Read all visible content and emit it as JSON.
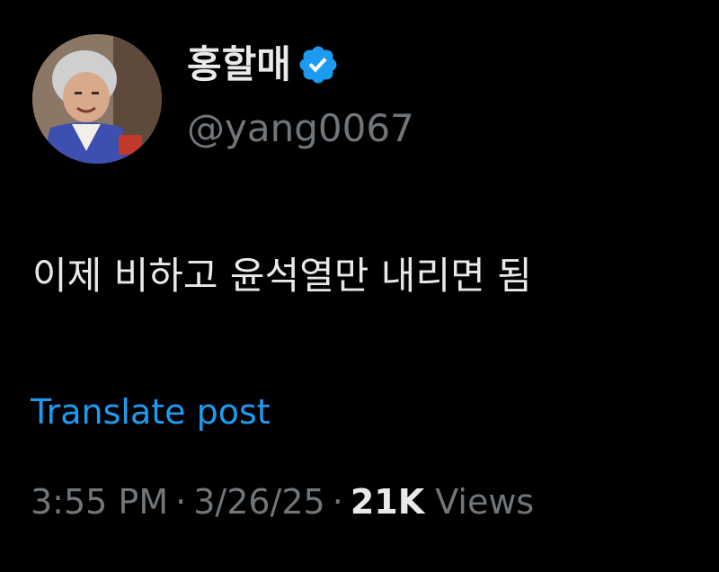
{
  "author": {
    "display_name": "홍할매",
    "handle": "@yang0067",
    "verified_icon": "verified-badge-icon",
    "accent": "#1d9bf0"
  },
  "post": {
    "text": "이제 비하고 윤석열만 내리면 됨"
  },
  "actions": {
    "translate_label": "Translate post"
  },
  "meta": {
    "time": "3:55 PM",
    "separator": "·",
    "date": "3/26/25",
    "views_count": "21K",
    "views_label": "Views"
  }
}
